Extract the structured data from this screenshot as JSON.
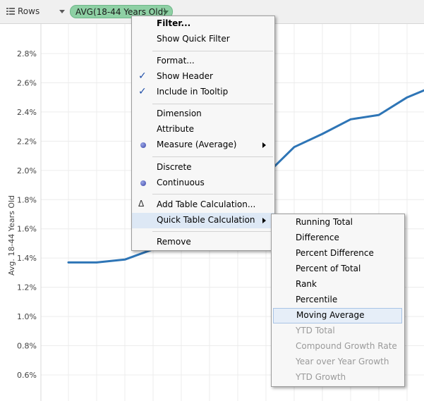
{
  "shelf": {
    "label": "Rows",
    "pill_label": "AVG(18-44 Years Old)"
  },
  "colors": {
    "line": "#2e75b6",
    "pill": "#8ed0a4",
    "menu_highlight": "#dde8f5"
  },
  "chart_data": {
    "type": "line",
    "ylabel": "Avg. 18-44 Years Old",
    "y_ticks": [
      "0.6%",
      "0.8%",
      "1.0%",
      "1.2%",
      "1.4%",
      "1.6%",
      "1.8%",
      "2.0%",
      "2.2%",
      "2.4%",
      "2.6%",
      "2.8%"
    ],
    "ylim": [
      0.5,
      2.9
    ],
    "series": [
      {
        "values": [
          1.37,
          1.37,
          1.39,
          1.46,
          1.52,
          1.62,
          1.78,
          1.97,
          2.16,
          2.25,
          2.35,
          2.38,
          2.5,
          2.58
        ]
      }
    ]
  },
  "context_menu": {
    "items": [
      {
        "label": "Filter...",
        "bold": true
      },
      {
        "label": "Show Quick Filter"
      },
      {
        "label": "Format..."
      },
      {
        "label": "Show Header",
        "checked": true
      },
      {
        "label": "Include in Tooltip",
        "checked": true
      },
      {
        "label": "Dimension"
      },
      {
        "label": "Attribute"
      },
      {
        "label": "Measure (Average)",
        "selected": true,
        "submenu": true
      },
      {
        "label": "Discrete"
      },
      {
        "label": "Continuous",
        "selected": true
      },
      {
        "label": "Add Table Calculation...",
        "icon": "delta-icon"
      },
      {
        "label": "Quick Table Calculation",
        "submenu": true,
        "highlighted": true
      },
      {
        "label": "Remove"
      }
    ]
  },
  "submenu": {
    "items": [
      {
        "label": "Running Total"
      },
      {
        "label": "Difference"
      },
      {
        "label": "Percent Difference"
      },
      {
        "label": "Percent of Total"
      },
      {
        "label": "Rank"
      },
      {
        "label": "Percentile"
      },
      {
        "label": "Moving Average",
        "highlighted": true
      },
      {
        "label": "YTD Total",
        "disabled": true
      },
      {
        "label": "Compound Growth Rate",
        "disabled": true
      },
      {
        "label": "Year over Year Growth",
        "disabled": true
      },
      {
        "label": "YTD Growth",
        "disabled": true
      }
    ]
  }
}
